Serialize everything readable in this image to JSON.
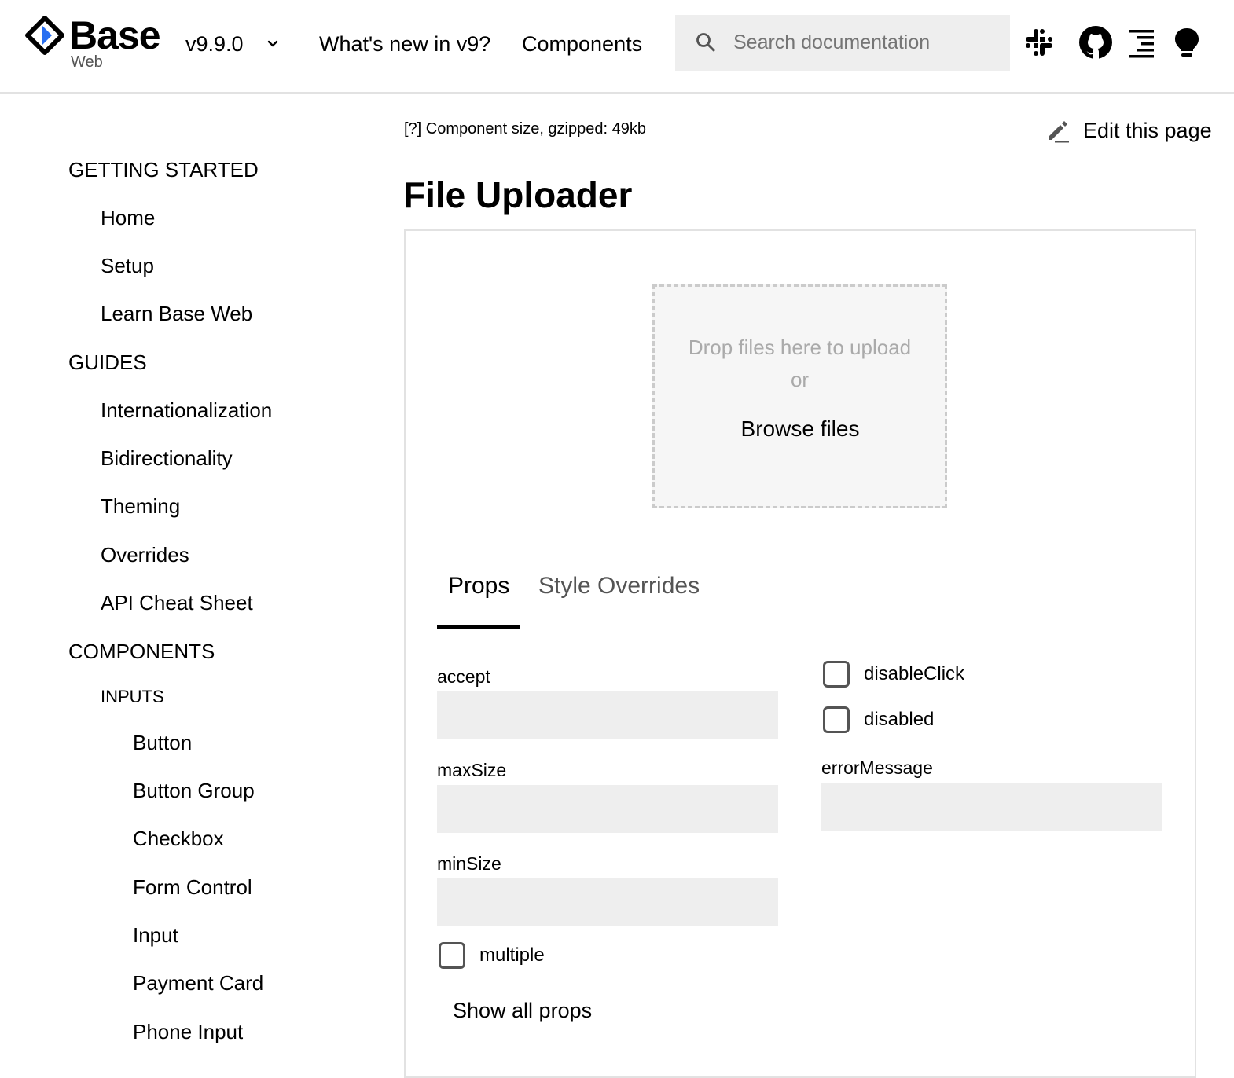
{
  "header": {
    "logo_name": "Base",
    "logo_sub": "Web",
    "version": "v9.9.0",
    "nav": [
      {
        "label": "What's new in v9?"
      },
      {
        "label": "Components"
      }
    ],
    "search": {
      "placeholder": "Search documentation",
      "value": ""
    },
    "icons": [
      "slack-icon",
      "github-icon",
      "table-of-contents-icon",
      "theme-bulb-icon"
    ]
  },
  "sidebar": {
    "getting_started": {
      "title": "GETTING STARTED",
      "items": [
        "Home",
        "Setup",
        "Learn Base Web"
      ]
    },
    "guides": {
      "title": "GUIDES",
      "items": [
        "Internationalization",
        "Bidirectionality",
        "Theming",
        "Overrides",
        "API Cheat Sheet"
      ]
    },
    "components": {
      "title": "COMPONENTS",
      "inputs": {
        "title": "INPUTS",
        "items": [
          "Button",
          "Button Group",
          "Checkbox",
          "Form Control",
          "Input",
          "Payment Card",
          "Phone Input"
        ]
      }
    }
  },
  "main": {
    "size_note": "[?] Component size, gzipped: 49kb",
    "edit_page": "Edit this page",
    "title": "File Uploader",
    "dropzone": {
      "prompt": "Drop files here to upload",
      "or": "or",
      "browse": "Browse files"
    },
    "tabs": [
      {
        "label": "Props",
        "active": true
      },
      {
        "label": "Style Overrides",
        "active": false
      }
    ],
    "props": {
      "accept": {
        "label": "accept",
        "value": ""
      },
      "maxSize": {
        "label": "maxSize",
        "value": ""
      },
      "minSize": {
        "label": "minSize",
        "value": ""
      },
      "multiple": {
        "label": "multiple",
        "checked": false
      },
      "disableClick": {
        "label": "disableClick",
        "checked": false
      },
      "disabled": {
        "label": "disabled",
        "checked": false
      },
      "errorMessage": {
        "label": "errorMessage",
        "value": ""
      }
    },
    "show_all": "Show all props"
  },
  "colors": {
    "accent": "#276EF1",
    "input_bg": "#EEEEEE",
    "border": "#E2E2E2",
    "dropzone_bg": "#F6F6F6",
    "muted_text": "#AAAAAA"
  }
}
